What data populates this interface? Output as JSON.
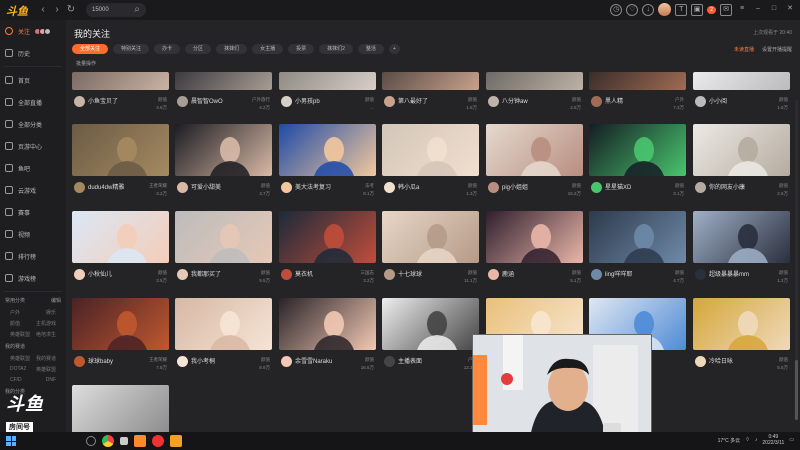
{
  "app": {
    "logo": "斗鱼",
    "search_value": "15000"
  },
  "topbar": {
    "notif_count": "2"
  },
  "sidebar": {
    "items": [
      {
        "label": "关注",
        "active": true
      },
      {
        "label": "历史"
      },
      {
        "label": "首页"
      },
      {
        "label": "全部直播"
      },
      {
        "label": "全部分类"
      },
      {
        "label": "页游中心"
      },
      {
        "label": "鱼吧"
      },
      {
        "label": "云游戏"
      },
      {
        "label": "赛事"
      },
      {
        "label": "视频"
      },
      {
        "label": "排行榜"
      },
      {
        "label": "游戏榜"
      }
    ],
    "section1": {
      "title": "常用分类",
      "action": "编辑"
    },
    "section1_items": [
      [
        "户外",
        "娱乐"
      ],
      [
        "颜值",
        "主机游戏"
      ],
      [
        "英雄联盟",
        "绝地求生"
      ]
    ],
    "section2": {
      "title": "我的赛道",
      "action": ""
    },
    "section2_items": [
      [
        "英雄联盟",
        "我的赛道"
      ],
      [
        "DOTA2",
        "英雄联盟"
      ],
      [
        "CF/D",
        "DNF"
      ]
    ],
    "section3": {
      "title": "我的分类"
    }
  },
  "main": {
    "title": "我的关注",
    "meta": "上次观看于 20:40",
    "filters": [
      "全部关注",
      "特别关注",
      "办卡",
      "分区",
      "抹抹们",
      "女主播",
      "投票",
      "抹抹们2",
      "整活"
    ],
    "filters_right": [
      "未读直播",
      "设置开播提醒"
    ],
    "batch": "批量操作"
  },
  "cards": [
    {
      "name": "小鱼宝贝了",
      "sub": "",
      "cat": "颜值",
      "heat": "4.6万"
    },
    {
      "name": "晨智智OwO",
      "sub": "",
      "cat": "户外旅行",
      "heat": "4.2万"
    },
    {
      "name": "小男孩pb",
      "sub": "",
      "cat": "颜值",
      "heat": "..."
    },
    {
      "name": "第八最好了",
      "sub": "",
      "cat": "颜值",
      "heat": "1.5万"
    },
    {
      "name": "八分钟aw",
      "sub": "",
      "cat": "颜值",
      "heat": "2.5万"
    },
    {
      "name": "黑人精",
      "sub": "",
      "cat": "户外",
      "heat": "7.3万"
    },
    {
      "name": "小小阅",
      "sub": "",
      "cat": "颜值",
      "heat": "1.5万"
    },
    {
      "name": "dudu4dw精雅",
      "sub": "",
      "cat": "王者荣耀",
      "heat": "3.2万"
    },
    {
      "name": "可爱小甜美",
      "sub": "",
      "cat": "颜值",
      "heat": "3.7万"
    },
    {
      "name": "美大法考复习",
      "sub": "",
      "cat": "法考",
      "heat": "8.1万"
    },
    {
      "name": "韩小瓜a",
      "sub": "",
      "cat": "颜值",
      "heat": "1.3万"
    },
    {
      "name": "pig小姐姐",
      "sub": "",
      "cat": "颜值",
      "heat": "16.2万"
    },
    {
      "name": "星星猫XD",
      "sub": "",
      "cat": "颜值",
      "heat": "3.1万"
    },
    {
      "name": "你的网友小康",
      "sub": "",
      "cat": "颜值",
      "heat": "2.6万"
    },
    {
      "name": "小秋仙儿",
      "sub": "",
      "cat": "颜值",
      "heat": "3.5万"
    },
    {
      "name": "我都那买了",
      "sub": "",
      "cat": "颜值",
      "heat": "9.5万"
    },
    {
      "name": "莫衣机",
      "sub": "",
      "cat": "三国志",
      "heat": "3.2万"
    },
    {
      "name": "十七球球",
      "sub": "",
      "cat": "颜值",
      "heat": "11.1万"
    },
    {
      "name": "鹿涵",
      "sub": "",
      "cat": "颜值",
      "heat": "5.1万"
    },
    {
      "name": "ling咩咩耶",
      "sub": "",
      "cat": "颜值",
      "heat": "4.7万"
    },
    {
      "name": "超级暴暴暴mm",
      "sub": "",
      "cat": "颜值",
      "heat": "1.2万"
    },
    {
      "name": "球球baby",
      "sub": "",
      "cat": "王者荣耀",
      "heat": "7.8万"
    },
    {
      "name": "我小考桐",
      "sub": "",
      "cat": "颜值",
      "heat": "8.9万"
    },
    {
      "name": "余雪雪Naraku",
      "sub": "",
      "cat": "颜值",
      "heat": "16.5万"
    },
    {
      "name": "主播表面",
      "sub": "",
      "cat": "户外",
      "heat": "12.2万"
    },
    {
      "name": "",
      "sub": "",
      "cat": "",
      "heat": ""
    },
    {
      "name": "",
      "sub": "",
      "cat": "",
      "heat": ""
    },
    {
      "name": "冷哈日咏",
      "sub": "",
      "cat": "颜值",
      "heat": "5.5万"
    }
  ],
  "watermark": {
    "brand": "斗鱼",
    "room_label": "房间号",
    "room_number": "241123"
  },
  "taskbar": {
    "weather": "17°C 多云",
    "time": "0:49",
    "date": "2022/3/11"
  }
}
